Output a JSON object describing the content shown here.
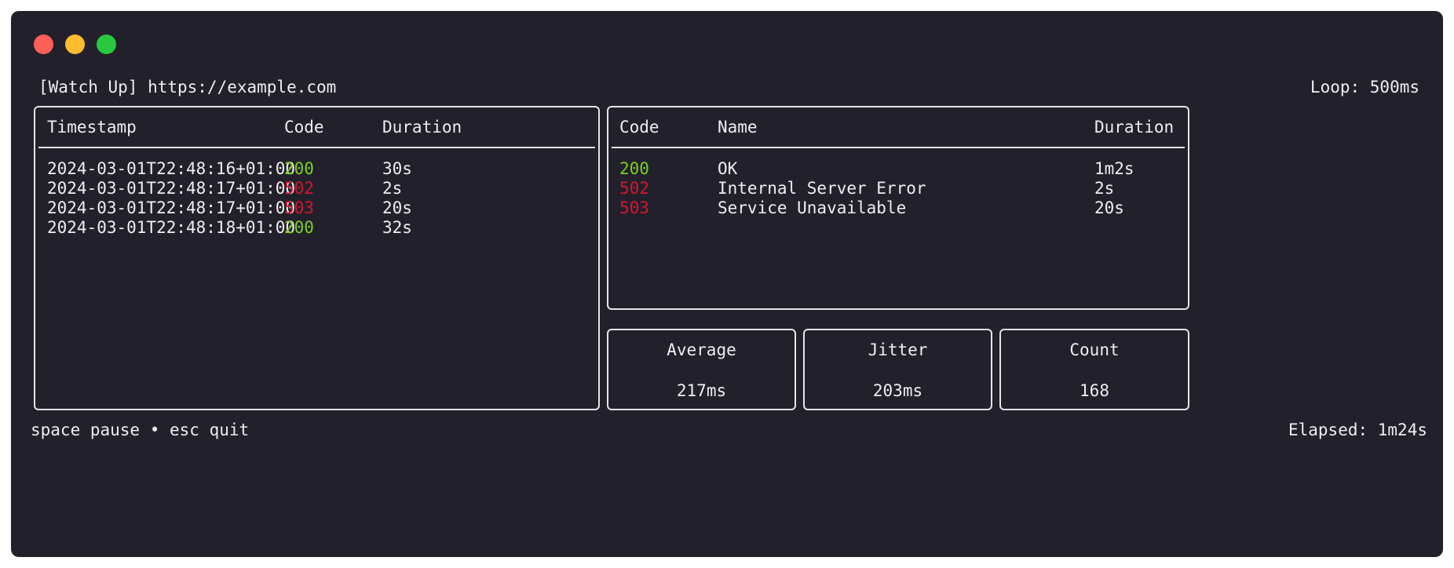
{
  "header": {
    "title": "[Watch Up] https://example.com",
    "loop": "Loop: 500ms"
  },
  "log_table": {
    "headers": [
      "Timestamp",
      "Code",
      "Duration"
    ],
    "rows": [
      {
        "timestamp": "2024-03-01T22:48:16+01:00",
        "code": "200",
        "duration": "30s"
      },
      {
        "timestamp": "2024-03-01T22:48:17+01:00",
        "code": "502",
        "duration": "2s"
      },
      {
        "timestamp": "2024-03-01T22:48:17+01:00",
        "code": "503",
        "duration": "20s"
      },
      {
        "timestamp": "2024-03-01T22:48:18+01:00",
        "code": "200",
        "duration": "32s"
      }
    ]
  },
  "summary_table": {
    "headers": [
      "Code",
      "Name",
      "Duration"
    ],
    "rows": [
      {
        "code": "200",
        "name": "OK",
        "duration": "1m2s"
      },
      {
        "code": "502",
        "name": "Internal Server Error",
        "duration": "2s"
      },
      {
        "code": "503",
        "name": "Service Unavailable",
        "duration": "20s"
      }
    ]
  },
  "stats": {
    "average": {
      "label": "Average",
      "value": "217ms"
    },
    "jitter": {
      "label": "Jitter",
      "value": "203ms"
    },
    "count": {
      "label": "Count",
      "value": "168"
    }
  },
  "footer": {
    "help": "space pause • esc quit",
    "elapsed": "Elapsed: 1m24s"
  },
  "colors": {
    "window_bg": "#22212b",
    "ok": "#7ccf1f",
    "error": "#d41530",
    "text": "#eeeef0",
    "close": "#fe5f57",
    "minimize": "#febc2e",
    "maximize": "#28c840"
  }
}
